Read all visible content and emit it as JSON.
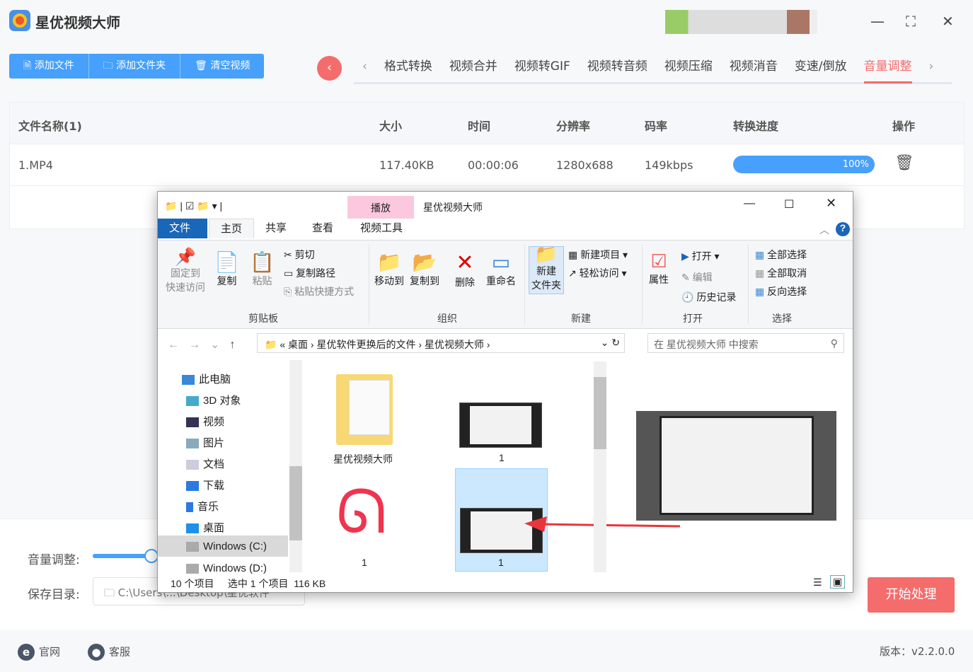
{
  "app": {
    "title": "星优视频大师",
    "version": "版本：v2.2.0.0"
  },
  "toolbar": {
    "add_file": "添加文件",
    "add_folder": "添加文件夹",
    "clear": "清空视频"
  },
  "tabs": [
    "格式转换",
    "视频合并",
    "视频转GIF",
    "视频转音频",
    "视频压缩",
    "视频消音",
    "变速/倒放",
    "音量调整"
  ],
  "table": {
    "headers": [
      "文件名称(1)",
      "大小",
      "时间",
      "分辨率",
      "码率",
      "转换进度",
      "操作"
    ],
    "rows": [
      {
        "name": "1.MP4",
        "size": "117.40KB",
        "time": "00:00:06",
        "resolution": "1280x688",
        "bitrate": "149kbps",
        "progress": "100%"
      }
    ]
  },
  "settings": {
    "volume_label": "音量调整:",
    "save_label": "保存目录:",
    "save_path": "C:\\Users\\...\\Desktop\\星优软件",
    "start": "开始处理"
  },
  "footer": {
    "site": "官网",
    "service": "客服"
  },
  "explorer": {
    "title": "星优视频大师",
    "context_tab": "播放",
    "ribbon_tabs": [
      "文件",
      "主页",
      "共享",
      "查看",
      "视频工具"
    ],
    "clipboard": {
      "pin": "固定到\n快速访问",
      "copy": "复制",
      "paste": "粘贴",
      "cut": "剪切",
      "copy_path": "复制路径",
      "paste_shortcut": "粘贴快捷方式",
      "group": "剪贴板"
    },
    "organize": {
      "move": "移动到",
      "copy": "复制到",
      "delete": "删除",
      "rename": "重命名",
      "group": "组织"
    },
    "new": {
      "folder": "新建\n文件夹",
      "item": "新建项目",
      "easy": "轻松访问",
      "group": "新建"
    },
    "open": {
      "props": "属性",
      "open": "打开",
      "edit": "编辑",
      "history": "历史记录",
      "group": "打开"
    },
    "select": {
      "all": "全部选择",
      "none": "全部取消",
      "invert": "反向选择",
      "group": "选择"
    },
    "breadcrumb": [
      "桌面",
      "星优软件更换后的文件",
      "星优视频大师"
    ],
    "search_placeholder": "在 星优视频大师 中搜索",
    "nav": [
      "此电脑",
      "3D 对象",
      "视频",
      "图片",
      "文档",
      "下载",
      "音乐",
      "桌面",
      "Windows (C:)",
      "Windows (D:)"
    ],
    "files": [
      {
        "name": "星优视频大师"
      },
      {
        "name": "1"
      },
      {
        "name": "1"
      },
      {
        "name": "1"
      }
    ],
    "status": {
      "count": "10 个项目",
      "selected": "选中 1 个项目",
      "size": "116 KB"
    }
  }
}
